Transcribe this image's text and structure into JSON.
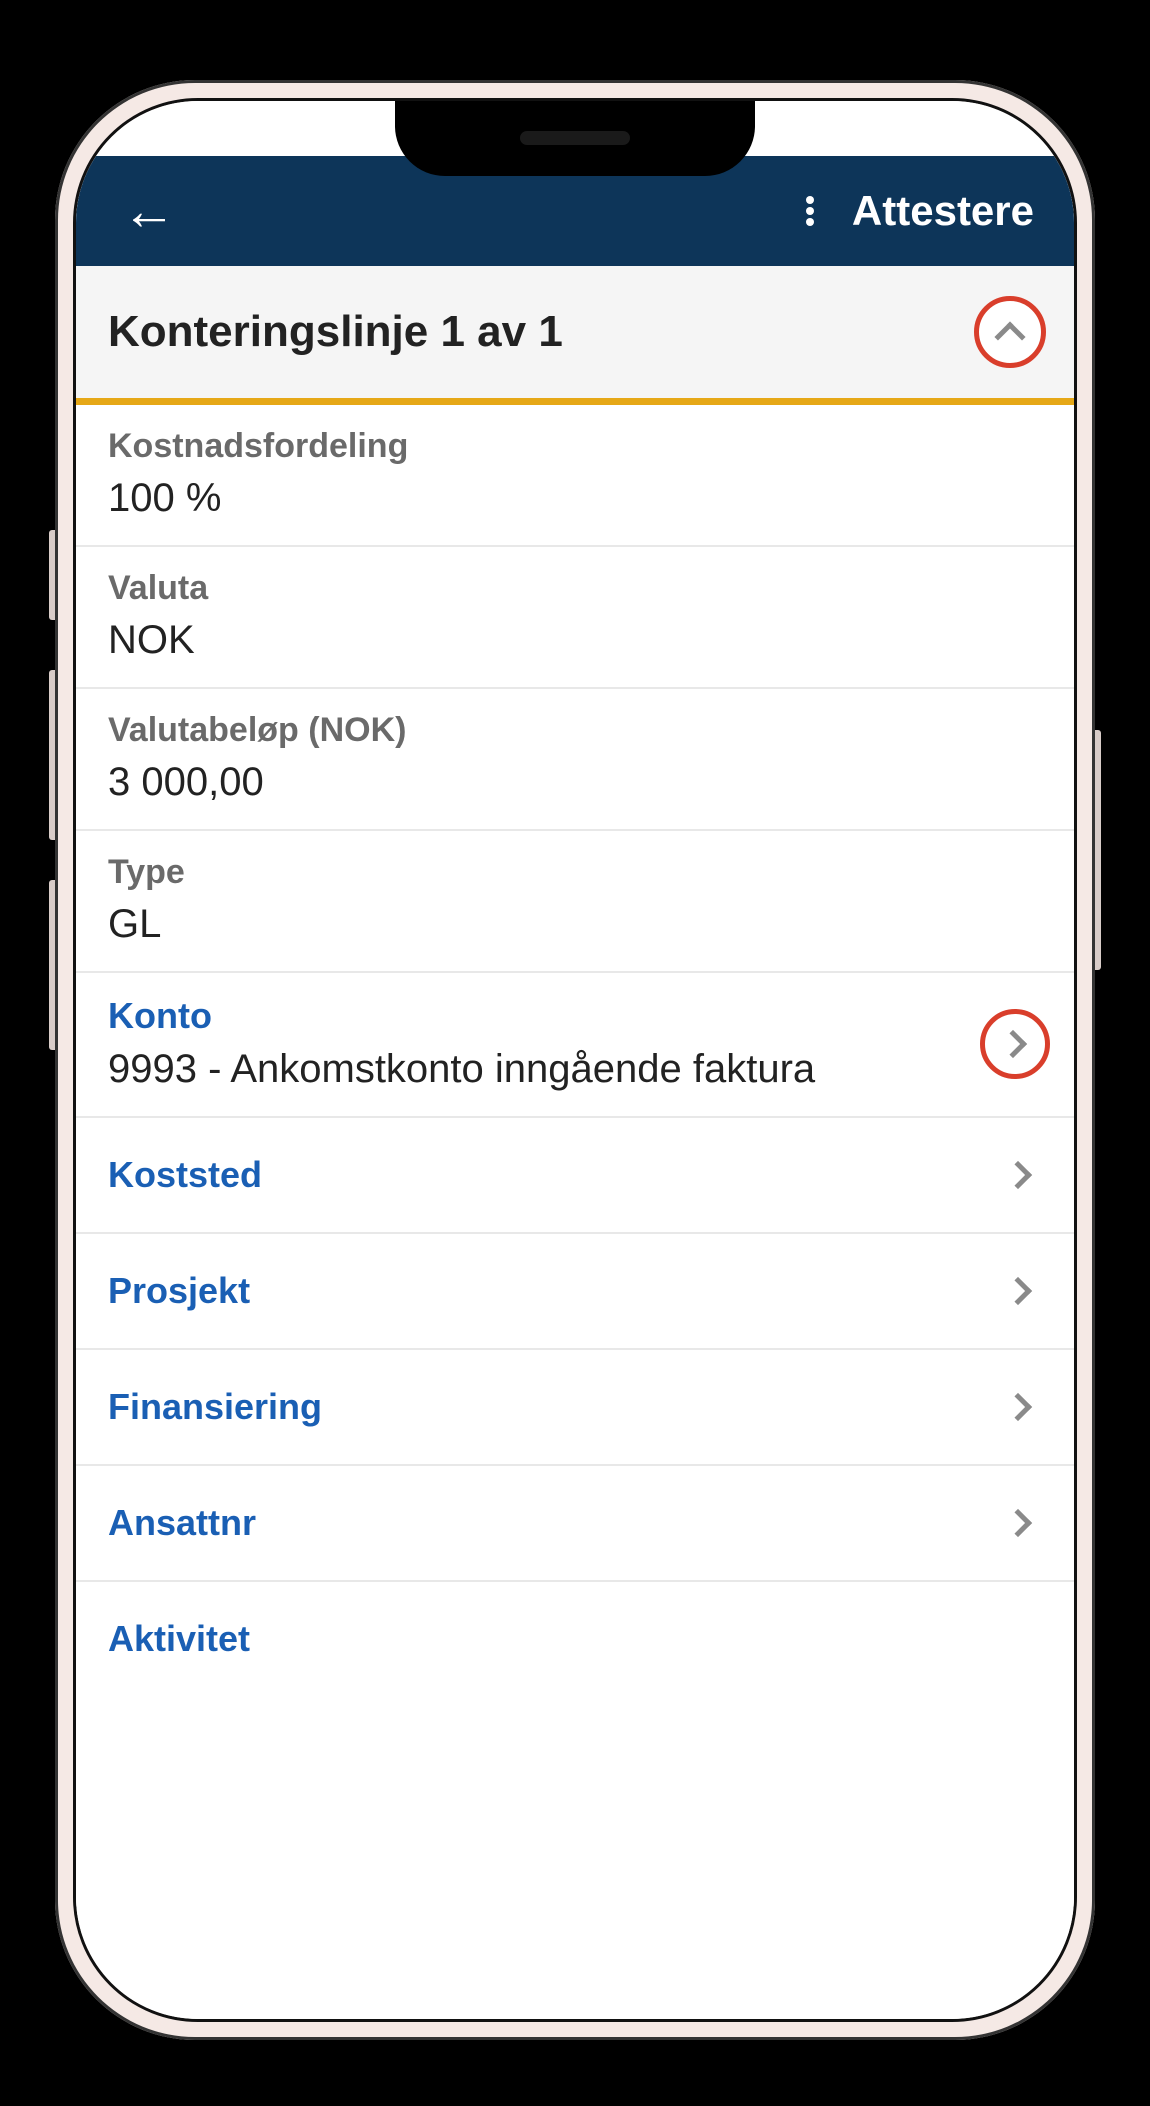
{
  "header": {
    "title": "Attestere"
  },
  "section": {
    "title": "Konteringslinje 1 av 1"
  },
  "fields": {
    "kostnadsfordeling": {
      "label": "Kostnadsfordeling",
      "value": "100 %"
    },
    "valuta": {
      "label": "Valuta",
      "value": "NOK"
    },
    "valutabelop": {
      "label": "Valutabeløp (NOK)",
      "value": "3 000,00"
    },
    "type": {
      "label": "Type",
      "value": "GL"
    },
    "konto": {
      "label": "Konto",
      "value": "9993 - Ankomstkonto inngående faktura"
    },
    "koststed": {
      "label": "Koststed"
    },
    "prosjekt": {
      "label": "Prosjekt"
    },
    "finansiering": {
      "label": "Finansiering"
    },
    "ansattnr": {
      "label": "Ansattnr"
    },
    "aktivitet": {
      "label": "Aktivitet"
    }
  }
}
